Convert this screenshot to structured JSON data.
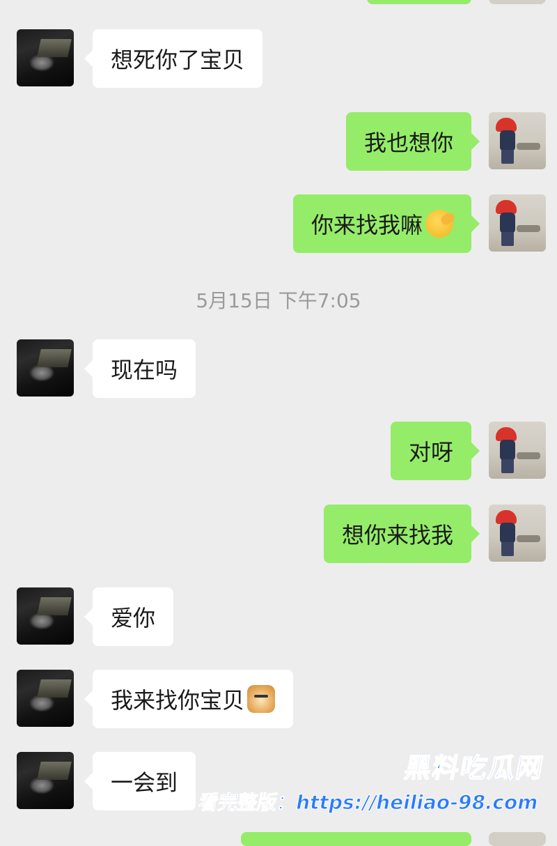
{
  "chat": {
    "timestamp": "5月15日 下午7:05",
    "messages": [
      {
        "side": "in",
        "text": "想死你了宝贝"
      },
      {
        "side": "out",
        "text": "我也想你"
      },
      {
        "side": "out",
        "text": "你来找我嘛",
        "emoji": "salute-emoji"
      },
      {
        "side": "in",
        "text": "现在吗"
      },
      {
        "side": "out",
        "text": "对呀"
      },
      {
        "side": "out",
        "text": "想你来找我"
      },
      {
        "side": "in",
        "text": "爱你"
      },
      {
        "side": "in",
        "text": "我来找你宝贝",
        "emoji": "doge-emoji"
      },
      {
        "side": "in",
        "text": "一会到"
      }
    ]
  },
  "watermark": {
    "title": "黑料吃瓜网",
    "label": "看完整版：",
    "url": "https://heiliao-98.com"
  },
  "colors": {
    "background": "#ededed",
    "incoming_bubble": "#ffffff",
    "outgoing_bubble": "#95ec69",
    "timestamp_text": "#9a9a9a",
    "watermark": "#2b7cff"
  }
}
